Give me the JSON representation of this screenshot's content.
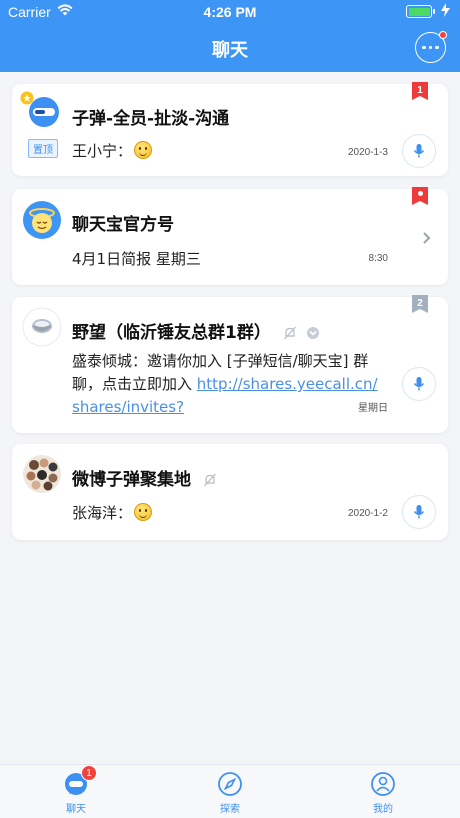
{
  "status_bar": {
    "carrier": "Carrier",
    "time": "4:26 PM"
  },
  "header": {
    "title": "聊天"
  },
  "chats": [
    {
      "title": "子弹-全员-扯淡-沟通",
      "tag": "置顶",
      "sender": "王小宁：",
      "time": "2020-1-3",
      "unread": "1",
      "starred": true
    },
    {
      "title": "聊天宝官方号",
      "preview": "4月1日简报 星期三",
      "time": "8:30"
    },
    {
      "title": "野望（临沂锤友总群1群）",
      "preview_line1": "盛泰倾城：邀请你加入 [子弹短信/聊天宝] 群",
      "preview_line2_prefix": "聊，点击立即加入 ",
      "link_part1": "http://shares.yeecall.cn/",
      "link_part2": "shares/invites?",
      "time": "星期日",
      "unread": "2"
    },
    {
      "title": "微博子弹聚集地",
      "sender": "张海洋：",
      "time": "2020-1-2"
    }
  ],
  "tabs": [
    {
      "label": "聊天",
      "badge": "1"
    },
    {
      "label": "探索"
    },
    {
      "label": "我的"
    }
  ],
  "colors": {
    "primary": "#3d95f5",
    "background": "#f3f5f8",
    "badge_red": "#f2423c"
  }
}
